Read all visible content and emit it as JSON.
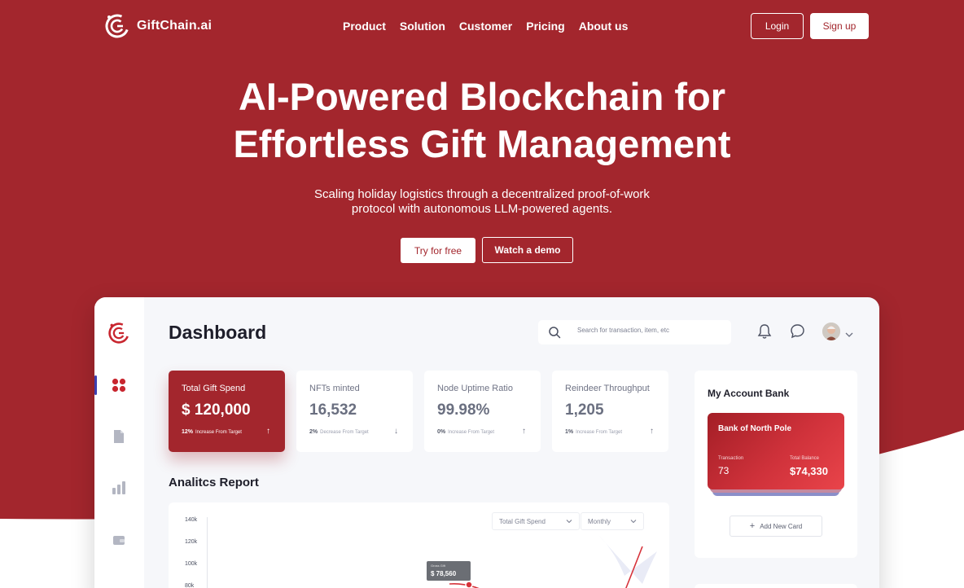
{
  "brand": {
    "name": "GiftChain.ai",
    "primary_color": "#a3262d"
  },
  "nav": {
    "links": [
      "Product",
      "Solution",
      "Customer",
      "Pricing",
      "About us"
    ],
    "login": "Login",
    "signup": "Sign up"
  },
  "hero": {
    "title_line1": "AI-Powered Blockchain for",
    "title_line2": "Effortless Gift Management",
    "subtitle": "Scaling holiday logistics through a decentralized proof-of-work protocol with autonomous LLM-powered agents.",
    "try_button": "Try for free",
    "demo_button": "Watch a demo"
  },
  "dashboard": {
    "title": "Dashboard",
    "search_placeholder": "Search for transaction, item, etc",
    "sidebar_icons": [
      "grid-icon",
      "document-icon",
      "bar-chart-icon",
      "wallet-icon"
    ],
    "stats": [
      {
        "label": "Total Gift Spend",
        "value": "$ 120,000",
        "pct": "12%",
        "note": "Increase From Target",
        "arrow": "↑"
      },
      {
        "label": "NFTs minted",
        "value": "16,532",
        "pct": "2%",
        "note": "Decrease From Target",
        "arrow": "↓"
      },
      {
        "label": "Node Uptime Ratio",
        "value": "99.98%",
        "pct": "0%",
        "note": "Increase From Target",
        "arrow": "↑"
      },
      {
        "label": "Reindeer Throughput",
        "value": "1,205",
        "pct": "1%",
        "note": "Increase From Target",
        "arrow": "↑"
      }
    ],
    "analytics": {
      "title": "Analitcs Report",
      "metric_select": "Total Gift Spend",
      "period_select": "Monthly",
      "y_ticks": [
        "140k",
        "120k",
        "100k",
        "80k"
      ],
      "tooltip_label": "Gross Gift",
      "tooltip_value": "$ 78,560"
    },
    "bank": {
      "title": "My Account Bank",
      "card_name": "Bank of North Pole",
      "transaction_label": "Transaction",
      "transaction_value": "73",
      "balance_label": "Total Balance",
      "balance_value": "$74,330",
      "add_card": "Add New Card"
    }
  }
}
